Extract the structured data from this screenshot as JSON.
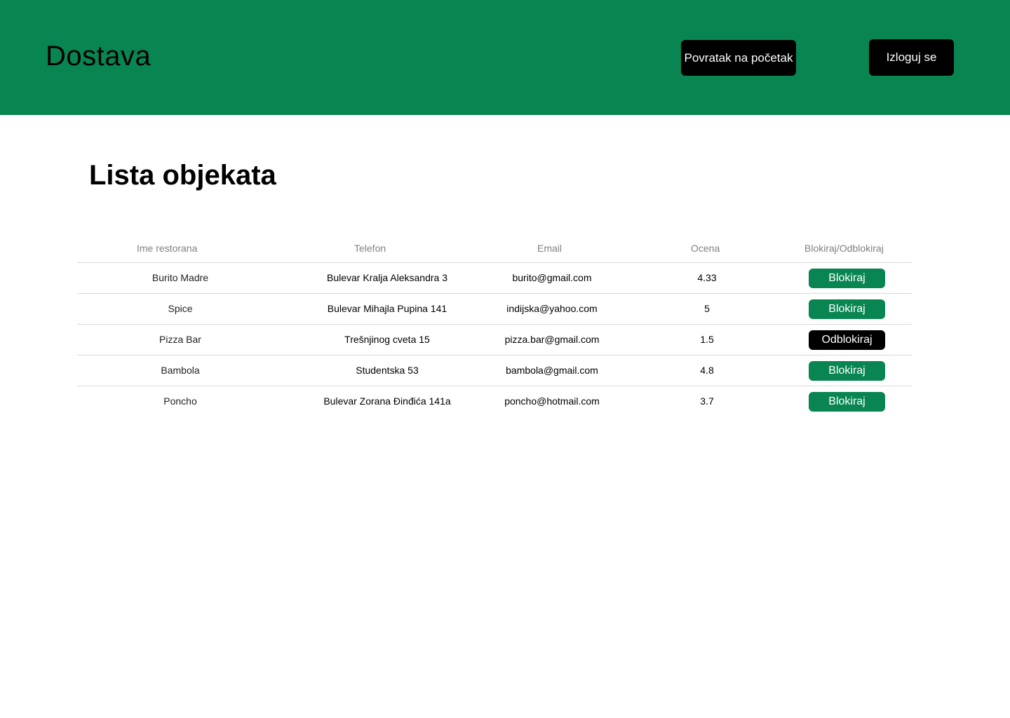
{
  "colors": {
    "brand_green": "#098552",
    "black": "#000000",
    "white": "#ffffff",
    "header_text": "#808080",
    "divider": "#d9d9d9"
  },
  "header": {
    "brand": "Dostava",
    "home_label": "Povratak na početak",
    "logout_label": "Izloguj se"
  },
  "main": {
    "title": "Lista objekata"
  },
  "table": {
    "columns": [
      "Ime restorana",
      "Telefon",
      "Email",
      "Ocena",
      "Blokiraj/Odblokiraj"
    ],
    "rows": [
      {
        "name": "Burito Madre",
        "phone": "Bulevar Kralja Aleksandra 3",
        "email": "burito@gmail.com",
        "rating": "4.33",
        "action": "Blokiraj",
        "blocked": false
      },
      {
        "name": "Spice",
        "phone": "Bulevar Mihajla Pupina 141",
        "email": "indijska@yahoo.com",
        "rating": "5",
        "action": "Blokiraj",
        "blocked": false
      },
      {
        "name": "Pizza Bar",
        "phone": "Trešnjinog cveta 15",
        "email": "pizza.bar@gmail.com",
        "rating": "1.5",
        "action": "Odblokiraj",
        "blocked": true
      },
      {
        "name": "Bambola",
        "phone": "Studentska 53",
        "email": "bambola@gmail.com",
        "rating": "4.8",
        "action": "Blokiraj",
        "blocked": false
      },
      {
        "name": "Poncho",
        "phone": "Bulevar Zorana Đinđića 141a",
        "email": "poncho@hotmail.com",
        "rating": "3.7",
        "action": "Blokiraj",
        "blocked": false
      }
    ]
  }
}
